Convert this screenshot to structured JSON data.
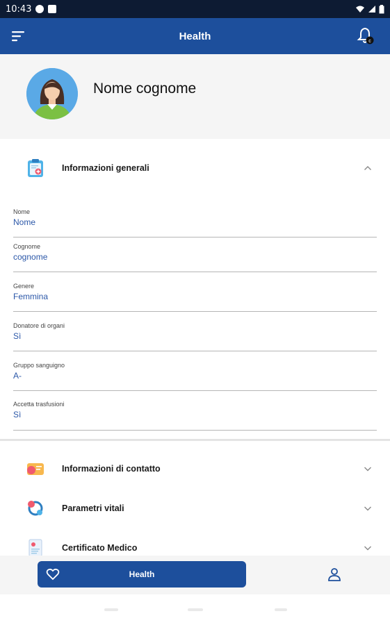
{
  "status_bar": {
    "time": "10:43"
  },
  "app_bar": {
    "title": "Health",
    "menu_icon": "menu-icon",
    "bell_icon": "bell-icon",
    "bell_badge": "c"
  },
  "profile": {
    "name": "Nome cognome",
    "avatar_icon": "avatar"
  },
  "general_info": {
    "title": "Informazioni generali",
    "icon": "clipboard-medical-icon",
    "expanded": true,
    "fields": [
      {
        "label": "Nome",
        "value": "Nome"
      },
      {
        "label": "Cognome",
        "value": "cognome"
      },
      {
        "label": "Genere",
        "value": "Femmina"
      },
      {
        "label": "Donatore di organi",
        "value": "Sì"
      },
      {
        "label": "Gruppo sanguigno",
        "value": "A-"
      },
      {
        "label": "Accetta trasfusioni",
        "value": "Sì"
      }
    ]
  },
  "sections": [
    {
      "title": "Informazioni di contatto",
      "icon": "contact-card-icon",
      "expanded": false
    },
    {
      "title": "Parametri vitali",
      "icon": "vital-signs-icon",
      "expanded": false
    },
    {
      "title": "Certificato Medico",
      "icon": "certificate-icon",
      "expanded": false
    }
  ],
  "bottom_nav": {
    "health_label": "Health",
    "health_icon": "heart-icon",
    "profile_icon": "person-icon"
  },
  "colors": {
    "primary": "#1d4f9c",
    "value_text": "#2b57a8",
    "status_bar": "#0d1b33"
  }
}
